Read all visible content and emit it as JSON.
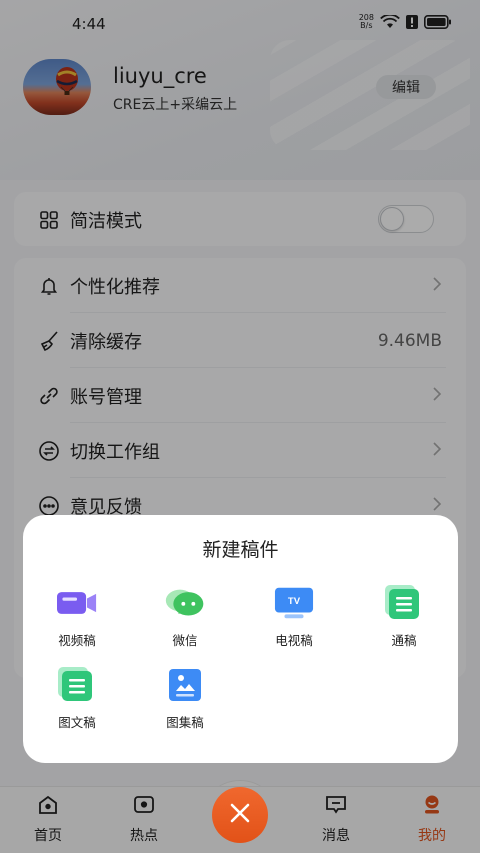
{
  "status_bar": {
    "time": "4:44",
    "net_speed_value": "208",
    "net_speed_unit": "B/s",
    "icons": [
      "wifi-icon",
      "alert-icon",
      "battery-icon"
    ]
  },
  "profile": {
    "username": "liuyu_cre",
    "organization": "CRE云上+采编云上",
    "edit_label": "编辑"
  },
  "simple_mode": {
    "label": "简洁模式",
    "icon": "grid-icon",
    "enabled": false
  },
  "settings": [
    {
      "label": "个性化推荐",
      "icon": "bell-icon",
      "value": ""
    },
    {
      "label": "清除缓存",
      "icon": "broom-icon",
      "value": "9.46MB"
    },
    {
      "label": "账号管理",
      "icon": "link-icon",
      "value": ""
    },
    {
      "label": "切换工作组",
      "icon": "swap-icon",
      "value": ""
    },
    {
      "label": "意见反馈",
      "icon": "chat-icon",
      "value": ""
    }
  ],
  "new_draft_sheet": {
    "title": "新建稿件",
    "options": [
      {
        "label": "视频稿",
        "icon": "video-camera-icon",
        "color": "#7a5cf0"
      },
      {
        "label": "微信",
        "icon": "wechat-icon",
        "color": "#3fc35f"
      },
      {
        "label": "电视稿",
        "icon": "tv-icon",
        "color": "#3d8bf5"
      },
      {
        "label": "通稿",
        "icon": "document-stack-icon",
        "color": "#2fc67a"
      },
      {
        "label": "图文稿",
        "icon": "document-stack-icon",
        "color": "#2fc67a"
      },
      {
        "label": "图集稿",
        "icon": "image-gallery-icon",
        "color": "#3d8bf5"
      }
    ]
  },
  "tabbar": {
    "tabs": [
      {
        "label": "首页",
        "icon": "home-icon"
      },
      {
        "label": "热点",
        "icon": "hot-icon"
      },
      {
        "label": "消息",
        "icon": "message-icon"
      },
      {
        "label": "我的",
        "icon": "profile-icon"
      }
    ],
    "active": "我的",
    "center_button_icon": "close-icon",
    "accent_color": "#e0541e"
  }
}
